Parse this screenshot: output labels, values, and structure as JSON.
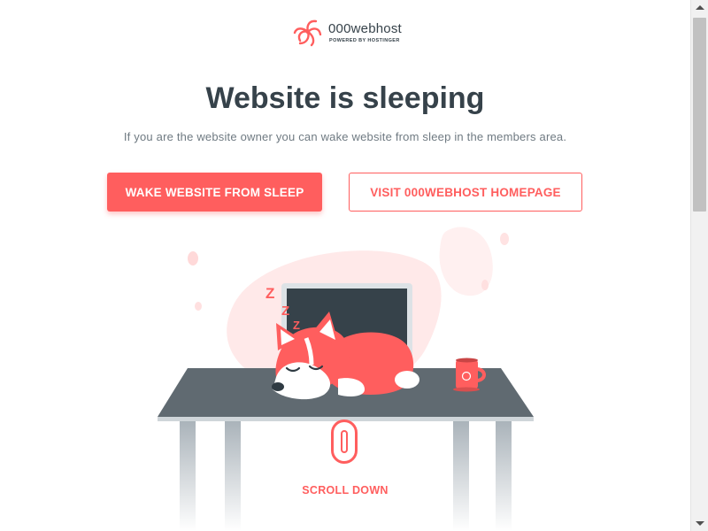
{
  "logo": {
    "brand": "000webhost",
    "tagline": "POWERED BY HOSTINGER",
    "icon": "swirl-logo-icon"
  },
  "hero": {
    "title": "Website is sleeping",
    "subtitle": "If you are the website owner you can wake website from sleep in the members area."
  },
  "buttons": {
    "wake": "WAKE WEBSITE FROM SLEEP",
    "visit": "VISIT 000WEBHOST HOMEPAGE"
  },
  "illustration": {
    "zzz": [
      "Z",
      "Z",
      "Z"
    ]
  },
  "scroll": {
    "label": "SCROLL DOWN",
    "icon": "mouse-scroll-icon"
  },
  "colors": {
    "accent": "#ff5e5e",
    "text_dark": "#36424a",
    "text_muted": "#6f7a82",
    "desk": "#606a71",
    "laptop_screen": "#36424a"
  }
}
